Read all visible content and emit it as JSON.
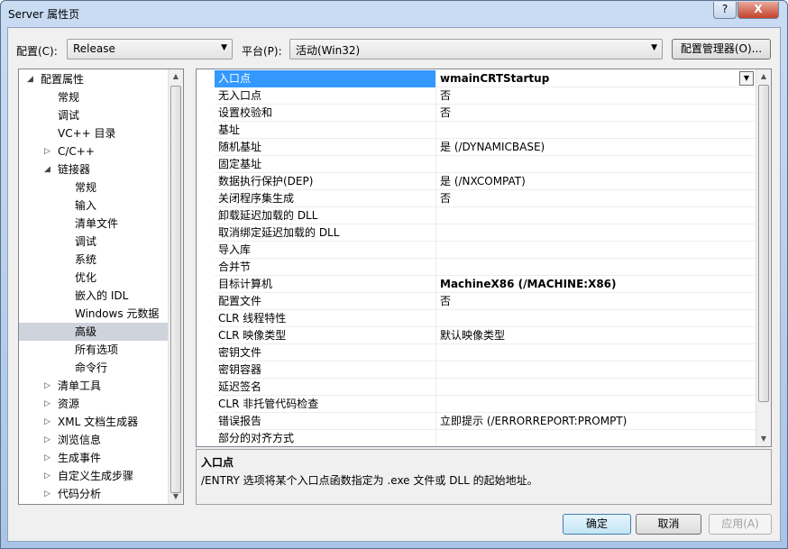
{
  "window": {
    "title": "Server 属性页",
    "help": "?",
    "close": "X"
  },
  "toolbar": {
    "config_label": "配置(C):",
    "config_value": "Release",
    "platform_label": "平台(P):",
    "platform_value": "活动(Win32)",
    "config_manager": "配置管理器(O)..."
  },
  "tree": [
    {
      "label": "配置属性",
      "level": 0,
      "expander": "expanded"
    },
    {
      "label": "常规",
      "level": 1
    },
    {
      "label": "调试",
      "level": 1
    },
    {
      "label": "VC++ 目录",
      "level": 1
    },
    {
      "label": "C/C++",
      "level": 1,
      "expander": "collapsed"
    },
    {
      "label": "链接器",
      "level": 1,
      "expander": "expanded"
    },
    {
      "label": "常规",
      "level": 2
    },
    {
      "label": "输入",
      "level": 2
    },
    {
      "label": "清单文件",
      "level": 2
    },
    {
      "label": "调试",
      "level": 2
    },
    {
      "label": "系统",
      "level": 2
    },
    {
      "label": "优化",
      "level": 2
    },
    {
      "label": "嵌入的 IDL",
      "level": 2
    },
    {
      "label": "Windows 元数据",
      "level": 2
    },
    {
      "label": "高级",
      "level": 2,
      "selected": true
    },
    {
      "label": "所有选项",
      "level": 2
    },
    {
      "label": "命令行",
      "level": 2
    },
    {
      "label": "清单工具",
      "level": 1,
      "expander": "collapsed"
    },
    {
      "label": "资源",
      "level": 1,
      "expander": "collapsed"
    },
    {
      "label": "XML 文档生成器",
      "level": 1,
      "expander": "collapsed"
    },
    {
      "label": "浏览信息",
      "level": 1,
      "expander": "collapsed"
    },
    {
      "label": "生成事件",
      "level": 1,
      "expander": "collapsed"
    },
    {
      "label": "自定义生成步骤",
      "level": 1,
      "expander": "collapsed"
    },
    {
      "label": "代码分析",
      "level": 1,
      "expander": "collapsed"
    }
  ],
  "properties": [
    {
      "name": "入口点",
      "value": "wmainCRTStartup",
      "bold": true,
      "selected": true
    },
    {
      "name": "无入口点",
      "value": "否"
    },
    {
      "name": "设置校验和",
      "value": "否"
    },
    {
      "name": "基址",
      "value": ""
    },
    {
      "name": "随机基址",
      "value": "是 (/DYNAMICBASE)"
    },
    {
      "name": "固定基址",
      "value": ""
    },
    {
      "name": "数据执行保护(DEP)",
      "value": "是 (/NXCOMPAT)"
    },
    {
      "name": "关闭程序集生成",
      "value": "否"
    },
    {
      "name": "卸载延迟加载的 DLL",
      "value": ""
    },
    {
      "name": "取消绑定延迟加载的 DLL",
      "value": ""
    },
    {
      "name": "导入库",
      "value": ""
    },
    {
      "name": "合并节",
      "value": ""
    },
    {
      "name": "目标计算机",
      "value": "MachineX86 (/MACHINE:X86)",
      "bold": true
    },
    {
      "name": "配置文件",
      "value": "否"
    },
    {
      "name": "CLR 线程特性",
      "value": ""
    },
    {
      "name": "CLR 映像类型",
      "value": "默认映像类型"
    },
    {
      "name": "密钥文件",
      "value": ""
    },
    {
      "name": "密钥容器",
      "value": ""
    },
    {
      "name": "延迟签名",
      "value": ""
    },
    {
      "name": "CLR 非托管代码检查",
      "value": ""
    },
    {
      "name": "错误报告",
      "value": "立即提示 (/ERRORREPORT:PROMPT)"
    },
    {
      "name": "部分的对齐方式",
      "value": ""
    }
  ],
  "description": {
    "title": "入口点",
    "text": "/ENTRY 选项将某个入口点函数指定为 .exe 文件或 DLL 的起始地址。"
  },
  "buttons": {
    "ok": "确定",
    "cancel": "取消",
    "apply": "应用(A)"
  }
}
